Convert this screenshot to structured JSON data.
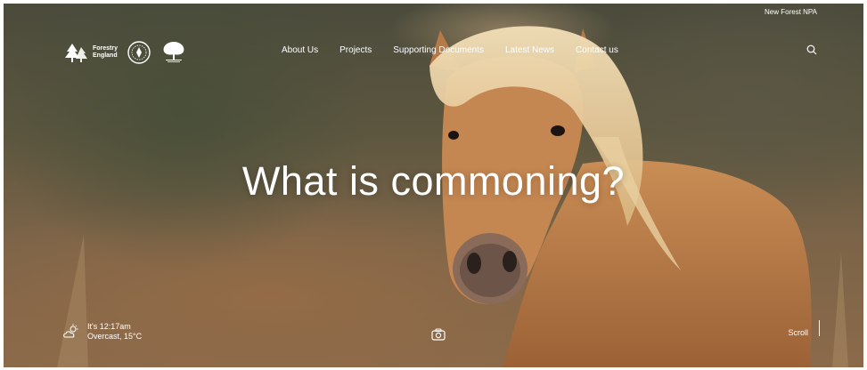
{
  "header": {
    "top_link": "New Forest NPA",
    "logos": [
      {
        "name": "forestry-england-logo",
        "text_line1": "Forestry",
        "text_line2": "England"
      },
      {
        "name": "verderers-seal-logo"
      },
      {
        "name": "commoners-tree-logo"
      }
    ],
    "nav": [
      "About Us",
      "Projects",
      "Supporting Documents",
      "Latest News",
      "Contact us"
    ],
    "search_icon": "search-icon"
  },
  "hero": {
    "headline": "What is commoning?",
    "image_subject": "pony-photo"
  },
  "footer": {
    "weather": {
      "time": "It's 12:17am",
      "condition": "Overcast, 15°C",
      "icon": "cloud-sun-icon"
    },
    "camera_icon": "camera-icon",
    "scroll_label": "Scroll"
  },
  "colors": {
    "text": "#ffffff",
    "page_bg": "#ffffff"
  }
}
